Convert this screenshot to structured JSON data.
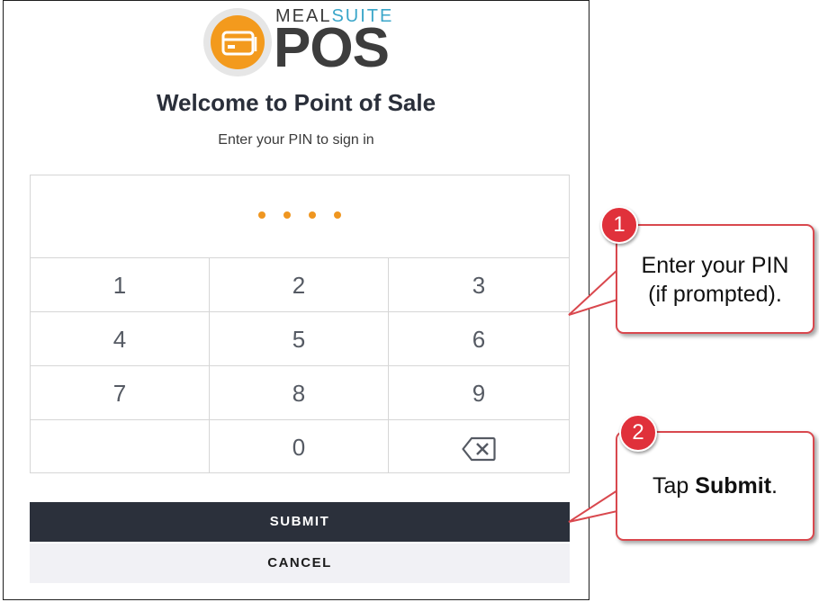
{
  "logo": {
    "brand_prefix": "MEAL",
    "brand_suffix": "SUITE",
    "product": "POS"
  },
  "header": {
    "title": "Welcome to Point of Sale",
    "subtitle": "Enter your PIN to sign in"
  },
  "pin": {
    "entered_digits": 4,
    "dot_color": "#ef9620"
  },
  "keypad": {
    "keys": [
      "1",
      "2",
      "3",
      "4",
      "5",
      "6",
      "7",
      "8",
      "9",
      "",
      "0",
      "backspace-icon"
    ]
  },
  "actions": {
    "submit_label": "SUBMIT",
    "cancel_label": "CANCEL"
  },
  "callouts": [
    {
      "number": "1",
      "line1": "Enter your PIN",
      "line2": "(if prompted)."
    },
    {
      "number": "2",
      "prefix": "Tap ",
      "bold": "Submit",
      "suffix": "."
    }
  ],
  "colors": {
    "accent_orange": "#f39a1d",
    "dark_button": "#2b303b",
    "callout_red": "#e0313b"
  }
}
